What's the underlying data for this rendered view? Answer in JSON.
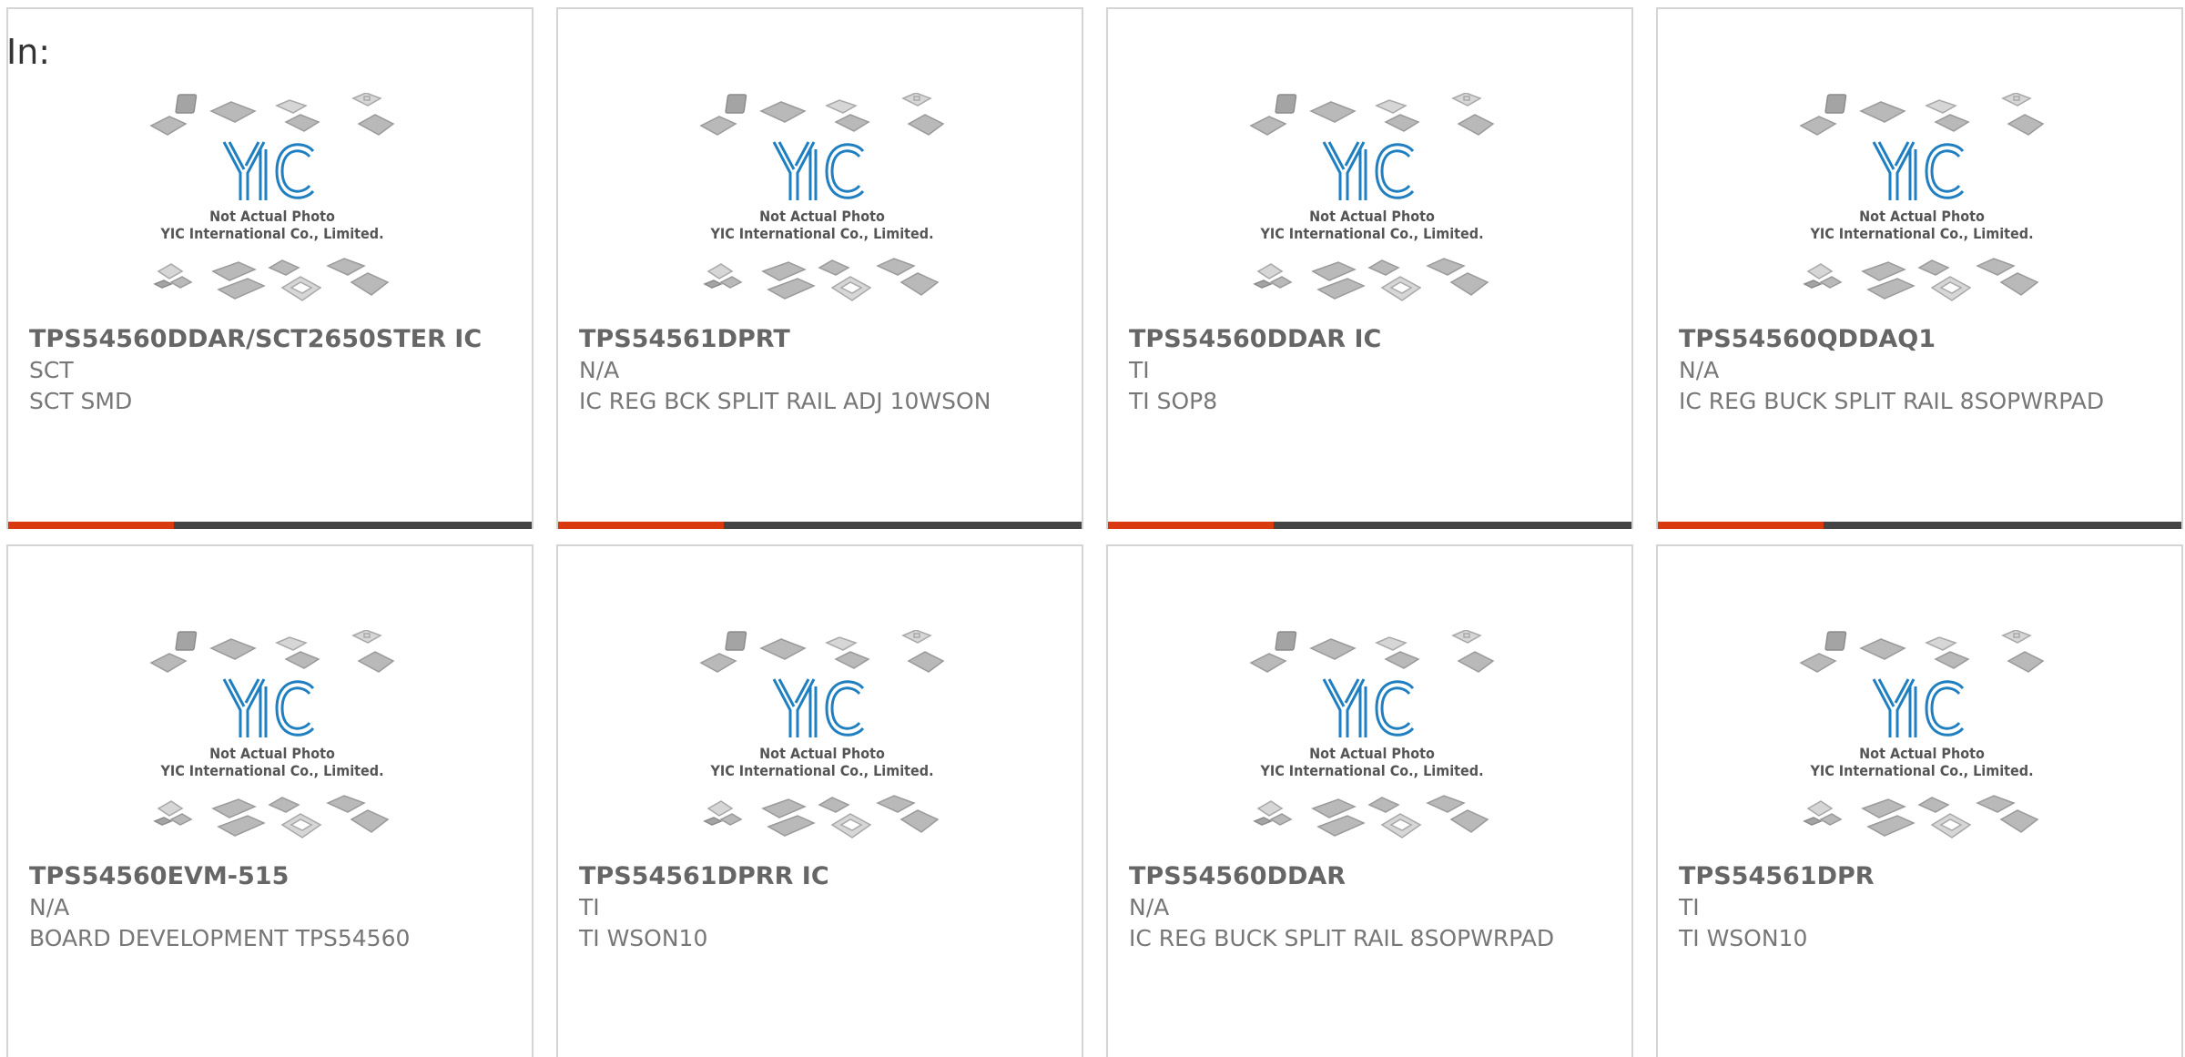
{
  "page": {
    "label": "In:"
  },
  "placeholder_image": {
    "line1": "Not Actual Photo",
    "line2": "YIC International Co., Limited.",
    "logo_icon": "yic-logo-icon"
  },
  "colors": {
    "accent": "#d9390f",
    "bar": "#444444",
    "logo_blue": "#1f7fc0",
    "text": "#666666",
    "border": "#d4d4d4"
  },
  "products": [
    {
      "part": "TPS54560DDAR/SCT2650STER IC",
      "manufacturer": "SCT",
      "description": "SCT SMD"
    },
    {
      "part": "TPS54561DPRT",
      "manufacturer": "N/A",
      "description": "IC REG BCK SPLIT RAIL ADJ 10WSON"
    },
    {
      "part": "TPS54560DDAR IC",
      "manufacturer": "TI",
      "description": "TI SOP8"
    },
    {
      "part": "TPS54560QDDAQ1",
      "manufacturer": "N/A",
      "description": "IC REG BUCK SPLIT RAIL 8SOPWRPAD"
    },
    {
      "part": "TPS54560EVM-515",
      "manufacturer": "N/A",
      "description": "BOARD DEVELOPMENT TPS54560"
    },
    {
      "part": "TPS54561DPRR IC",
      "manufacturer": "TI",
      "description": "TI WSON10"
    },
    {
      "part": "TPS54560DDAR",
      "manufacturer": "N/A",
      "description": "IC REG BUCK SPLIT RAIL 8SOPWRPAD"
    },
    {
      "part": "TPS54561DPR",
      "manufacturer": "TI",
      "description": "TI WSON10"
    }
  ]
}
